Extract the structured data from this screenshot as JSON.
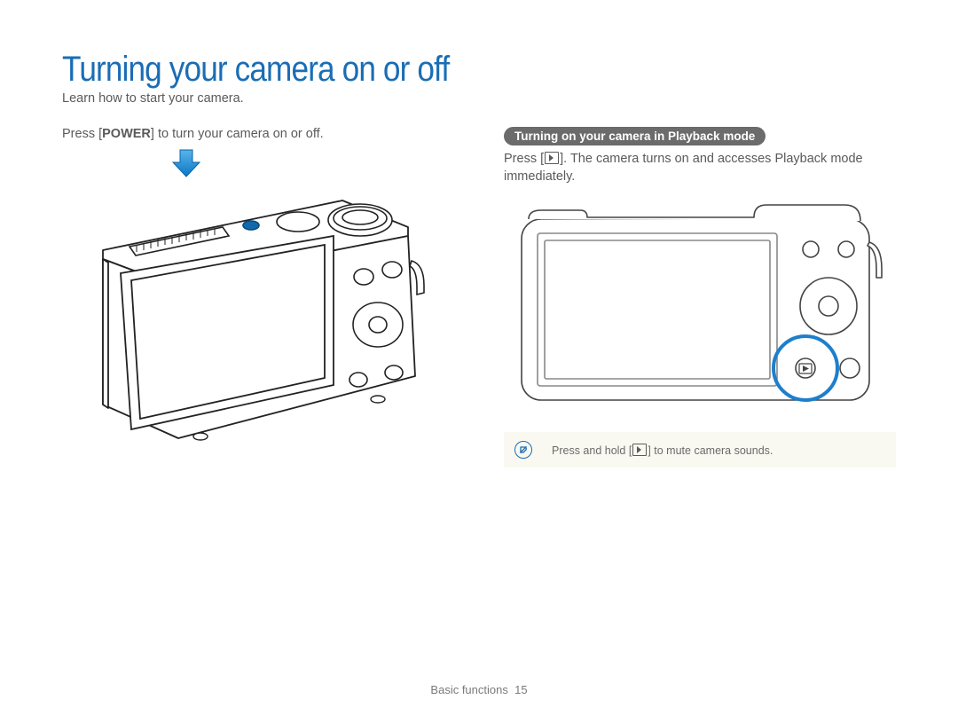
{
  "title": "Turning your camera on or off",
  "subtitle": "Learn how to start your camera.",
  "left": {
    "press_prefix": "Press [",
    "power_label": "POWER",
    "press_suffix": "] to turn your camera on or off."
  },
  "right": {
    "pill": "Turning on your camera in Playback mode",
    "press_prefix": "Press [",
    "press_suffix": "]. The camera turns on and accesses Playback mode immediately."
  },
  "note": {
    "prefix": "Press and hold [",
    "suffix": "] to mute camera sounds."
  },
  "footer": {
    "section": "Basic functions",
    "page": "15"
  }
}
